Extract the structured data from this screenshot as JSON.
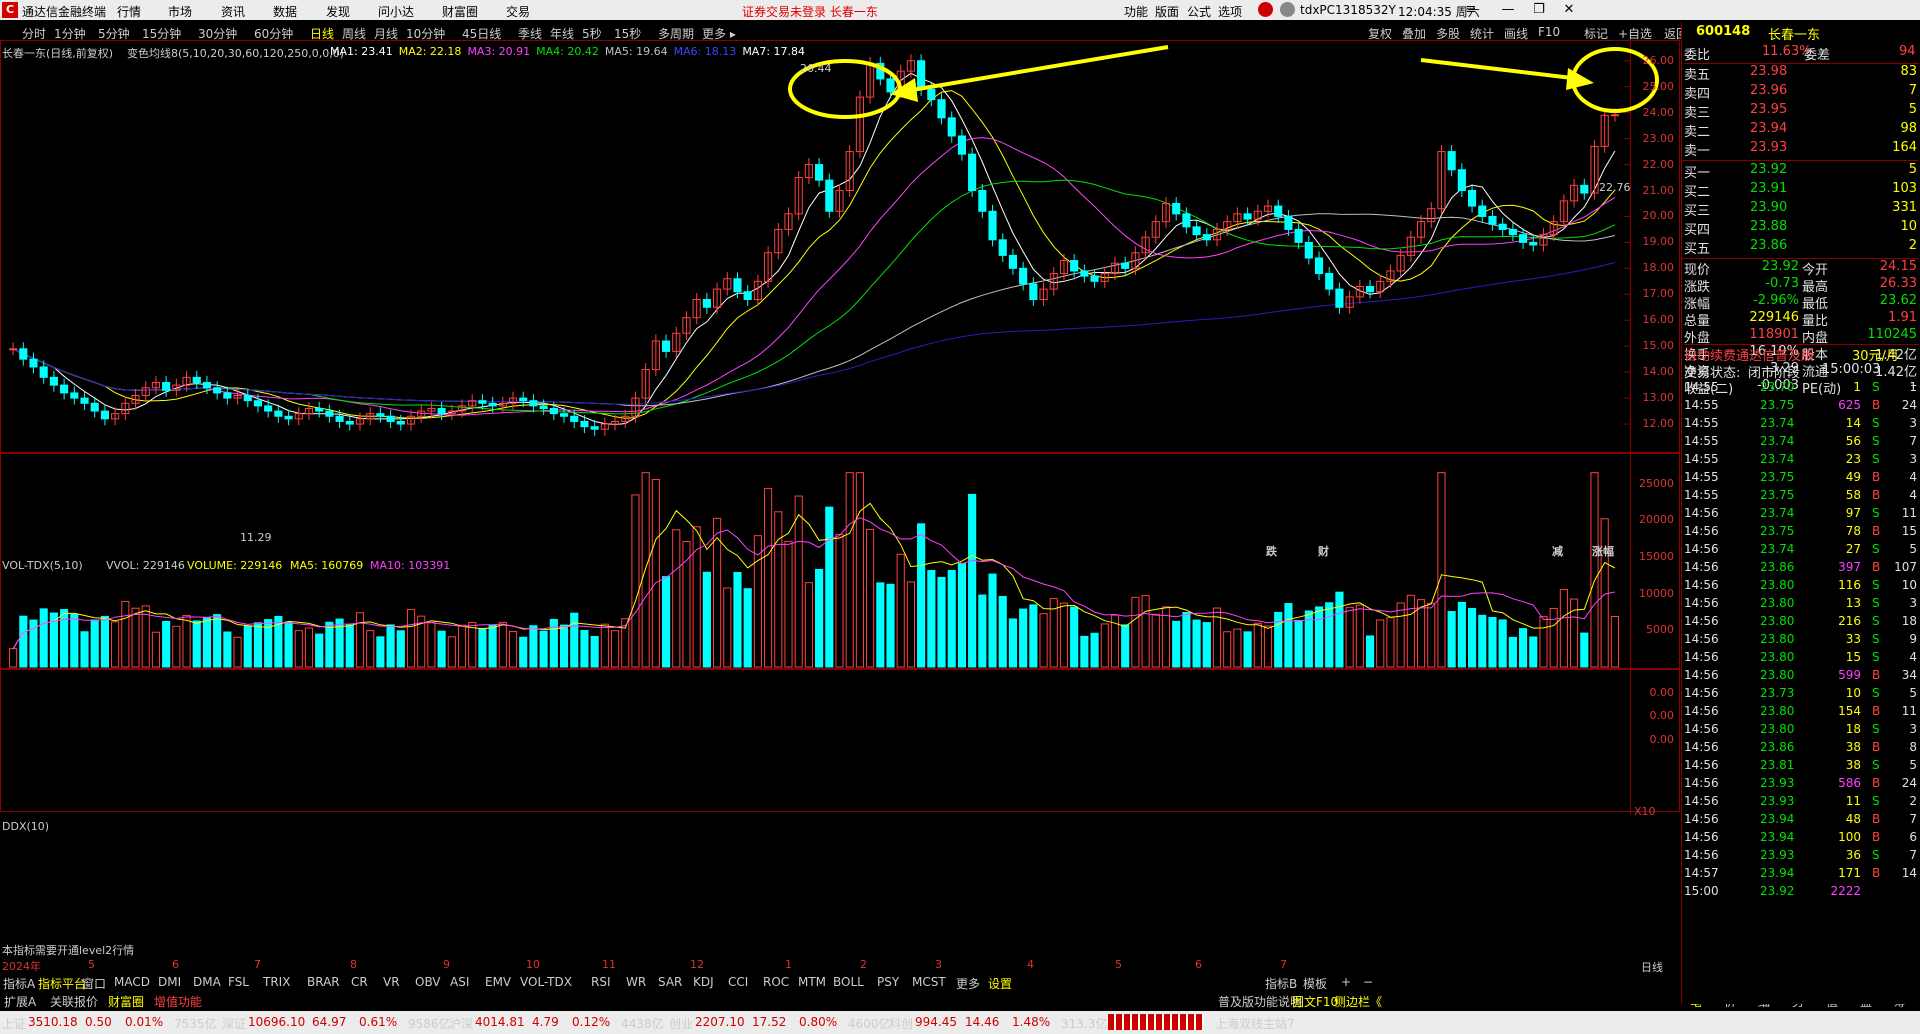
{
  "titlebar": {
    "app_name": "通达信金融终端",
    "menus": [
      "行情",
      "市场",
      "资讯",
      "数据",
      "发现",
      "问小达",
      "财富圈",
      "交易"
    ],
    "notice": "证券交易未登录  长春一东",
    "right_menus": [
      "功能",
      "版面",
      "公式",
      "选项"
    ],
    "user": "tdxPC1318532Y",
    "time": "12:04:35 周六"
  },
  "period_bar": {
    "items": [
      "分时",
      "1分钟",
      "5分钟",
      "15分钟",
      "30分钟",
      "60分钟",
      "日线",
      "周线",
      "月线",
      "10分钟",
      "45日线",
      "季线",
      "年线",
      "5秒",
      "15秒",
      "多周期",
      "更多 ▸"
    ],
    "active": "日线"
  },
  "top_tools": [
    "复权",
    "叠加",
    "多股",
    "统计",
    "画线",
    "F10",
    "标记",
    "+自选",
    "返回"
  ],
  "main_chart": {
    "legend_title": "长春一东(日线,前复权)",
    "legend_indicator": "变色均线8(5,10,20,30,60,120,250,0,0,0)",
    "ma_labels": [
      {
        "text": "MA1: 23.41",
        "color": "#ffffff"
      },
      {
        "text": "MA2: 22.18",
        "color": "#ffff00"
      },
      {
        "text": "MA3: 20.91",
        "color": "#ff40ff"
      },
      {
        "text": "MA4: 20.42",
        "color": "#00e000"
      },
      {
        "text": "MA5: 19.64",
        "color": "#c0c0c0"
      },
      {
        "text": "MA6: 18.13",
        "color": "#4040ff"
      },
      {
        "text": "MA7: 17.84",
        "color": "#ffffff"
      }
    ],
    "y_ticks": [
      "26.00",
      "25.00",
      "24.00",
      "23.00",
      "22.00",
      "21.00",
      "20.00",
      "19.00",
      "18.00",
      "17.00",
      "16.00",
      "15.00",
      "14.00",
      "13.00",
      "12.00"
    ],
    "high_mark": "26.44",
    "low_mark": "11.29",
    "last_mark": "22.76",
    "event_tags": [
      {
        "text": "跌",
        "color": "#00e000"
      },
      {
        "text": "财",
        "color": "#4080ff"
      },
      {
        "text": "减",
        "color": "#00e000"
      },
      {
        "text": "涨幅",
        "color": "#ff4040"
      }
    ]
  },
  "volume_chart": {
    "legend": "VOL-TDX(5,10)",
    "vvol": "VVOL: 229146",
    "volume": "VOLUME: 229146",
    "ma5": "MA5: 160769",
    "ma10": "MA10: 103391",
    "y_ticks": [
      "25000",
      "20000",
      "15000",
      "10000",
      "5000"
    ],
    "unit": "X10"
  },
  "ddx_chart": {
    "legend": "DDX(10)",
    "y_ticks": [
      "0.00",
      "0.00",
      "0.00"
    ],
    "note": "本指标需要开通level2行情"
  },
  "x_axis": {
    "labels": [
      "2024年",
      "5",
      "6",
      "7",
      "8",
      "9",
      "10",
      "11",
      "12",
      "1",
      "2",
      "3",
      "4",
      "5",
      "6",
      "7"
    ],
    "period_label": "日线"
  },
  "indicator_bar": {
    "items": [
      "指标A",
      "指标平台",
      "窗口",
      "MACD",
      "DMI",
      "DMA",
      "FSL",
      "TRIX",
      "BRAR",
      "CR",
      "VR",
      "OBV",
      "ASI",
      "EMV",
      "VOL-TDX",
      "RSI",
      "WR",
      "SAR",
      "KDJ",
      "CCI",
      "ROC",
      "MTM",
      "BOLL",
      "PSY",
      "MCST",
      "更多",
      "设置"
    ],
    "right_items": [
      "指标B",
      "模板",
      "+",
      "−"
    ]
  },
  "sub_bar": {
    "items": [
      "扩展A",
      "关联报价",
      "财富圈",
      "增值功能"
    ],
    "right_text": "普及版功能说明",
    "right_text2": "图文F10",
    "right_text3": "侧边栏《",
    "side_items": [
      "笔",
      "价",
      "细",
      "势",
      "值",
      "盘",
      "筹"
    ]
  },
  "right_panel": {
    "code": "600148",
    "name": "长春一东",
    "weibi_label": "委比",
    "weibi_value": "11.63%",
    "weicha_label": "委差",
    "weicha_value": "94",
    "asks": [
      {
        "label": "卖五",
        "price": "23.98",
        "vol": "83"
      },
      {
        "label": "卖四",
        "price": "23.96",
        "vol": "7"
      },
      {
        "label": "卖三",
        "price": "23.95",
        "vol": "5"
      },
      {
        "label": "卖二",
        "price": "23.94",
        "vol": "98"
      },
      {
        "label": "卖一",
        "price": "23.93",
        "vol": "164"
      }
    ],
    "bids": [
      {
        "label": "买一",
        "price": "23.92",
        "vol": "5"
      },
      {
        "label": "买二",
        "price": "23.91",
        "vol": "103"
      },
      {
        "label": "买三",
        "price": "23.90",
        "vol": "331"
      },
      {
        "label": "买四",
        "price": "23.88",
        "vol": "10"
      },
      {
        "label": "买五",
        "price": "23.86",
        "vol": "2"
      }
    ],
    "quote": [
      {
        "l1": "现价",
        "v1": "23.92",
        "c1": "c-green",
        "l2": "今开",
        "v2": "24.15",
        "c2": "c-red"
      },
      {
        "l1": "涨跌",
        "v1": "-0.73",
        "c1": "c-green",
        "l2": "最高",
        "v2": "26.33",
        "c2": "c-red"
      },
      {
        "l1": "涨幅",
        "v1": "-2.96%",
        "c1": "c-green",
        "l2": "最低",
        "v2": "23.62",
        "c2": "c-green"
      },
      {
        "l1": "总量",
        "v1": "229146",
        "c1": "c-yellow",
        "l2": "量比",
        "v2": "1.91",
        "c2": "c-red"
      },
      {
        "l1": "外盘",
        "v1": "118901",
        "c1": "c-red",
        "l2": "内盘",
        "v2": "110245",
        "c2": "c-green"
      },
      {
        "l1": "换手",
        "v1": "16.19%",
        "c1": "c-white",
        "l2": "股本",
        "v2": "1.42亿",
        "c2": "c-white"
      },
      {
        "l1": "净资",
        "v1": "3.29",
        "c1": "c-white",
        "l2": "流通",
        "v2": "1.42亿",
        "c2": "c-white"
      },
      {
        "l1": "收益(二)",
        "v1": "-0.003",
        "c1": "c-white",
        "l2": "PE(动)",
        "v2": "–",
        "c2": "c-white"
      }
    ],
    "ad_text": "自动续费通达信普及版",
    "ad_price": "30元/月",
    "status_label": "交易状态:",
    "status_value": "闭市阶段",
    "status_time": "15:00:03",
    "ticks": [
      {
        "t": "14:55",
        "p": "23.70",
        "v": "1",
        "bs": "S",
        "n": "1"
      },
      {
        "t": "14:55",
        "p": "23.75",
        "v": "625",
        "bs": "B",
        "n": "24"
      },
      {
        "t": "14:55",
        "p": "23.74",
        "v": "14",
        "bs": "S",
        "n": "3"
      },
      {
        "t": "14:55",
        "p": "23.74",
        "v": "56",
        "bs": "S",
        "n": "7"
      },
      {
        "t": "14:55",
        "p": "23.74",
        "v": "23",
        "bs": "S",
        "n": "3"
      },
      {
        "t": "14:55",
        "p": "23.75",
        "v": "49",
        "bs": "B",
        "n": "4"
      },
      {
        "t": "14:55",
        "p": "23.75",
        "v": "58",
        "bs": "B",
        "n": "4"
      },
      {
        "t": "14:56",
        "p": "23.74",
        "v": "97",
        "bs": "S",
        "n": "11"
      },
      {
        "t": "14:56",
        "p": "23.75",
        "v": "78",
        "bs": "B",
        "n": "15"
      },
      {
        "t": "14:56",
        "p": "23.74",
        "v": "27",
        "bs": "S",
        "n": "5"
      },
      {
        "t": "14:56",
        "p": "23.86",
        "v": "397",
        "bs": "B",
        "n": "107"
      },
      {
        "t": "14:56",
        "p": "23.80",
        "v": "116",
        "bs": "S",
        "n": "10"
      },
      {
        "t": "14:56",
        "p": "23.80",
        "v": "13",
        "bs": "S",
        "n": "3"
      },
      {
        "t": "14:56",
        "p": "23.80",
        "v": "216",
        "bs": "S",
        "n": "18"
      },
      {
        "t": "14:56",
        "p": "23.80",
        "v": "33",
        "bs": "S",
        "n": "9"
      },
      {
        "t": "14:56",
        "p": "23.80",
        "v": "15",
        "bs": "S",
        "n": "4"
      },
      {
        "t": "14:56",
        "p": "23.80",
        "v": "599",
        "bs": "B",
        "n": "34"
      },
      {
        "t": "14:56",
        "p": "23.73",
        "v": "10",
        "bs": "S",
        "n": "5"
      },
      {
        "t": "14:56",
        "p": "23.80",
        "v": "154",
        "bs": "B",
        "n": "11"
      },
      {
        "t": "14:56",
        "p": "23.80",
        "v": "18",
        "bs": "S",
        "n": "3"
      },
      {
        "t": "14:56",
        "p": "23.86",
        "v": "38",
        "bs": "B",
        "n": "8"
      },
      {
        "t": "14:56",
        "p": "23.81",
        "v": "38",
        "bs": "S",
        "n": "5"
      },
      {
        "t": "14:56",
        "p": "23.93",
        "v": "586",
        "bs": "B",
        "n": "24"
      },
      {
        "t": "14:56",
        "p": "23.93",
        "v": "11",
        "bs": "S",
        "n": "2"
      },
      {
        "t": "14:56",
        "p": "23.94",
        "v": "48",
        "bs": "B",
        "n": "7"
      },
      {
        "t": "14:56",
        "p": "23.94",
        "v": "100",
        "bs": "B",
        "n": "6"
      },
      {
        "t": "14:56",
        "p": "23.93",
        "v": "36",
        "bs": "S",
        "n": "7"
      },
      {
        "t": "14:57",
        "p": "23.94",
        "v": "171",
        "bs": "B",
        "n": "14"
      },
      {
        "t": "15:00",
        "p": "23.92",
        "v": "2222",
        "bs": "",
        "n": ""
      }
    ]
  },
  "status_bar": {
    "items": [
      {
        "name": "上证",
        "value": "3510.18",
        "chg": "0.50",
        "pct": "0.01%",
        "amt": "7535亿"
      },
      {
        "name": "深证",
        "value": "10696.10",
        "chg": "64.97",
        "pct": "0.61%",
        "amt": "9586亿"
      },
      {
        "name": "沪深",
        "value": "4014.81",
        "chg": "4.79",
        "pct": "0.12%",
        "amt": "4438亿"
      },
      {
        "name": "创业",
        "value": "2207.10",
        "chg": "17.52",
        "pct": "0.80%",
        "amt": "4600亿"
      },
      {
        "name": "科创",
        "value": "994.45",
        "chg": "14.46",
        "pct": "1.48%",
        "amt": "313.3亿"
      }
    ],
    "server": "上海双线主站7"
  },
  "colors": {
    "up": "#ff4040",
    "down": "#00ffff",
    "ma_yellow": "#ffff00",
    "ma_purple": "#ff40ff",
    "ma_green": "#00e000",
    "ma_blue": "#2020c0",
    "annotation": "#ffff00"
  },
  "chart_data": {
    "type": "candlestick",
    "series_note": "approximate daily OHLC reconstructed from price axis",
    "ylim": [
      11,
      26.8
    ],
    "closes": [
      14.9,
      14.5,
      14.2,
      13.8,
      13.5,
      13.2,
      13.0,
      12.8,
      12.5,
      12.2,
      12.4,
      12.8,
      13.1,
      13.4,
      13.6,
      13.3,
      13.5,
      13.8,
      13.6,
      13.4,
      13.2,
      13.0,
      13.1,
      12.9,
      12.7,
      12.5,
      12.3,
      12.2,
      12.4,
      12.6,
      12.5,
      12.3,
      12.1,
      12.0,
      12.2,
      12.4,
      12.3,
      12.1,
      12.0,
      12.3,
      12.5,
      12.6,
      12.4,
      12.5,
      12.7,
      12.9,
      12.8,
      12.7,
      12.8,
      13.0,
      12.9,
      12.7,
      12.6,
      12.4,
      12.3,
      12.1,
      11.9,
      11.8,
      12.0,
      12.1,
      12.3,
      13.0,
      14.1,
      15.2,
      14.8,
      15.5,
      16.1,
      16.8,
      16.5,
      17.2,
      17.6,
      17.1,
      16.8,
      17.5,
      18.6,
      19.5,
      20.1,
      21.5,
      22.0,
      21.4,
      20.2,
      21.0,
      22.5,
      24.6,
      25.9,
      25.3,
      24.8,
      25.6,
      26.0,
      24.9,
      24.5,
      23.8,
      23.1,
      22.4,
      21.0,
      20.2,
      19.1,
      18.5,
      18.0,
      17.4,
      16.8,
      17.2,
      17.8,
      18.3,
      17.9,
      17.7,
      17.5,
      17.8,
      18.2,
      18.0,
      18.6,
      19.2,
      19.8,
      20.5,
      20.1,
      19.6,
      19.3,
      19.1,
      19.5,
      19.8,
      20.1,
      19.9,
      20.2,
      20.4,
      20.0,
      19.5,
      19.0,
      18.4,
      17.8,
      17.2,
      16.5,
      16.9,
      17.3,
      17.1,
      17.5,
      17.9,
      18.5,
      19.2,
      19.8,
      20.3,
      22.5,
      21.8,
      21.0,
      20.4,
      20.0,
      19.7,
      19.5,
      19.3,
      19.0,
      18.9,
      19.3,
      19.8,
      20.6,
      21.2,
      20.9,
      22.7,
      23.9,
      23.92
    ],
    "volume_ylim": [
      0,
      27000
    ]
  }
}
